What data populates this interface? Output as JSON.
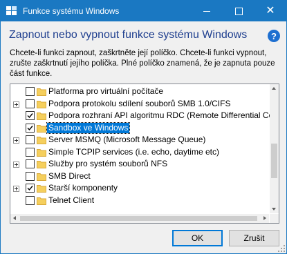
{
  "window": {
    "title": "Funkce systému Windows",
    "icon": "windows-features-icon",
    "controls": [
      "minimize-icon",
      "maximize-icon",
      "close-icon"
    ]
  },
  "header": {
    "heading": "Zapnout nebo vypnout funkce systému Windows",
    "help_icon": "?"
  },
  "description": "Chcete-li funkci zapnout, zaškrtněte její políčko. Chcete-li funkci vypnout, zrušte zaškrtnutí jejího políčka. Plné políčko znamená, že je zapnuta pouze část funkce.",
  "features": [
    {
      "label": "Platforma pro virtuální počítače",
      "checked": false,
      "expandable": false,
      "selected": false
    },
    {
      "label": "Podpora protokolu sdílení souborů SMB 1.0/CIFS",
      "checked": false,
      "expandable": true,
      "selected": false
    },
    {
      "label": "Podpora rozhraní API algoritmu RDC (Remote Differential Co",
      "checked": true,
      "expandable": false,
      "selected": false
    },
    {
      "label": "Sandbox ve Windows",
      "checked": true,
      "expandable": false,
      "selected": true
    },
    {
      "label": "Server MSMQ (Microsoft Message Queue)",
      "checked": false,
      "expandable": true,
      "selected": false
    },
    {
      "label": "Simple TCPIP services (i.e. echo, daytime etc)",
      "checked": false,
      "expandable": false,
      "selected": false
    },
    {
      "label": "Služby pro systém souborů NFS",
      "checked": false,
      "expandable": true,
      "selected": false
    },
    {
      "label": "SMB Direct",
      "checked": false,
      "expandable": false,
      "selected": false
    },
    {
      "label": "Starší komponenty",
      "checked": true,
      "expandable": true,
      "selected": false
    },
    {
      "label": "Telnet Client",
      "checked": false,
      "expandable": false,
      "selected": false
    }
  ],
  "buttons": {
    "ok": "OK",
    "cancel": "Zrušit"
  },
  "colors": {
    "titlebar": "#1a78c2",
    "heading": "#1f3f8f",
    "selection": "#0078d7",
    "folder": "#f5cf5d"
  }
}
